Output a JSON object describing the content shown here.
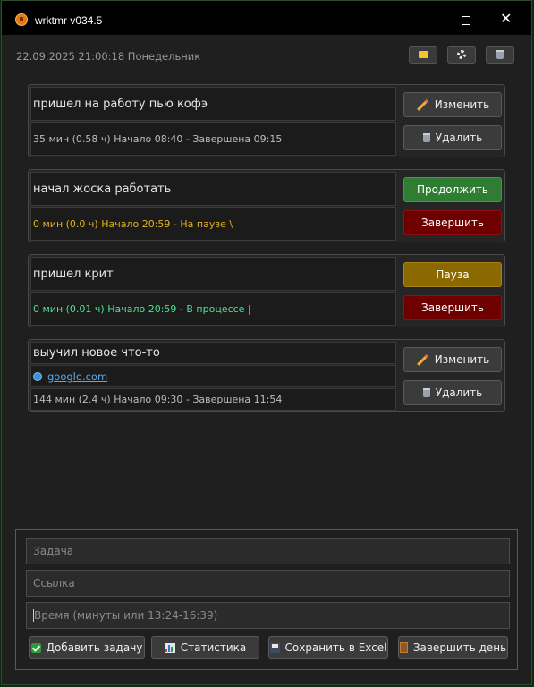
{
  "window": {
    "title": "wrktmr v034.5"
  },
  "header": {
    "datetime": "22.09.2025 21:00:18 Понедельник"
  },
  "tasks": [
    {
      "title": "пришел на работу пью кофэ",
      "meta": "35 мин (0.58 ч) Начало 08:40 - Завершена 09:15",
      "status": "done",
      "buttons": [
        "Изменить",
        "Удалить"
      ]
    },
    {
      "title": "начал жоска работать",
      "meta": "0 мин (0.0 ч) Начало 20:59 - На паузе \\",
      "status": "paused",
      "buttons": [
        "Продолжить",
        "Завершить"
      ]
    },
    {
      "title": "пришел крит",
      "meta": "0 мин (0.01 ч) Начало 20:59 - В процессе |",
      "status": "running",
      "buttons": [
        "Пауза",
        "Завершить"
      ]
    },
    {
      "title": "выучил новое что-то",
      "link": "google.com",
      "meta": "144 мин (2.4 ч) Начало 09:30 - Завершена 11:54",
      "status": "done",
      "buttons": [
        "Изменить",
        "Удалить"
      ]
    }
  ],
  "form": {
    "task_placeholder": "Задача",
    "link_placeholder": "Ссылка",
    "time_placeholder": "Время (минуты или 13:24-16:39)",
    "buttons": {
      "add": "Добавить задачу",
      "stats": "Статистика",
      "save_excel": "Сохранить в Excel",
      "end_day": "Завершить день"
    }
  },
  "colors": {
    "continue": "#2e7d32",
    "finish": "#6e0000",
    "pause": "#8a6a00",
    "paused_text": "#e3b21d",
    "running_text": "#4fe08f",
    "link": "#5aa8e8"
  }
}
